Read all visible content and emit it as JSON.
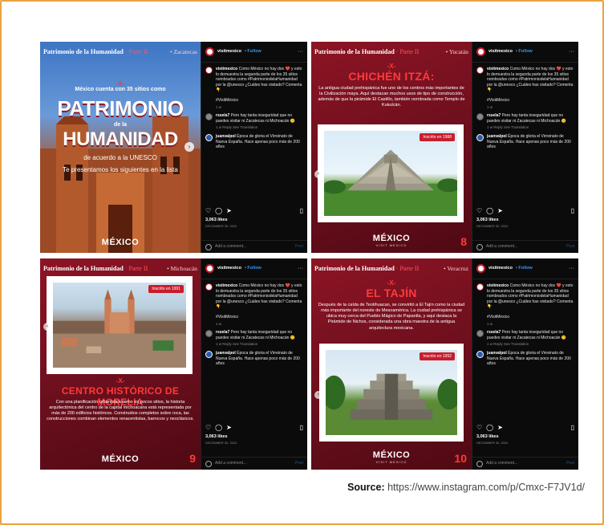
{
  "source": {
    "label": "Source:",
    "url": "https://www.instagram.com/p/Cmxc-F7JV1d/"
  },
  "common": {
    "series_title": "Patrimonio de la Humanidad",
    "part": "· Parte II",
    "brand": "MÉXICO",
    "brand_sub": "VISIT MEXICO",
    "account": "visitmexico",
    "follow": "• Follow",
    "caption": "Como México no hay dos ❤️ y esto lo demuestra la segunda parte de los 35 sitios nombrados como #PatrimoniodelaHumanidad por la @unesco ¿Cuáles has visitado? Comenta 👇",
    "hashtag": "#VisitMéxico",
    "caption_age": "1 w",
    "comment1_user": "rssela7",
    "comment1_text": "Pero hay tanta inseguridad que no puedes visitar ni Zacatecas ni Michoacán 😕",
    "comment1_meta": "1 w  Reply  See Translation",
    "comment2_user": "juanvalpol",
    "comment2_text": "Época de gloria el Virreinato de Nueva España. Hace apenas poco más de 200 años",
    "likes": "3,063 likes",
    "date": "DECEMBER 30, 2022",
    "add_comment": "Add a comment...",
    "post": "Post"
  },
  "panels": [
    {
      "region": "• Zacatecas",
      "x": "-X-",
      "intro": "México cuenta con 35 sitios como",
      "big1": "PATRIMONIO",
      "delala": "de la",
      "big2": "HUMANIDAD",
      "unesco": "de acuerdo a la UNESCO",
      "present": "Te presentamos los siguientes en la lista"
    },
    {
      "region": "• Yucatán",
      "x": "-X-",
      "site": "CHICHÉN ITZÁ:",
      "desc": "La antigua ciudad prehispánica fue uno de los centros más importantes de la Civilización maya. Aquí destacan muchos usos de tipo de construcción, además de que la pirámide El Castillo, también nombrada como Templo de Kukulcán.",
      "badge": "Inscrito en 1988",
      "page": "8"
    },
    {
      "region": "• Michoacán",
      "x": "-X-",
      "site": "CENTRO HISTÓRICO DE MORELIA",
      "desc": "Con una planificación urbanística como en pocos sitios, la historia arquitectónica del centro de la capital michoacana está representada por más de 200 edificios históricos. Construidos completos sobre roca, las construcciones combinan elementos renacentistas, barrocos y neoclásicos.",
      "badge": "Inscrito en 1991",
      "page": "9"
    },
    {
      "region": "• Veracruz",
      "x": "-X-",
      "site": "EL TAJÍN",
      "desc": "Después de la caída de Teotihuacan, se convirtió a El Tajín como la ciudad más importante del noreste de Mesoamérica. La ciudad prehispánica se ubica muy cerca del Pueblo Mágico de Papantla, y aquí destaca la Pirámide de Nichos, considerada una obra maestra de la antigua arquitectura mexicana.",
      "badge": "Inscrito en 1992",
      "page": "10"
    }
  ]
}
